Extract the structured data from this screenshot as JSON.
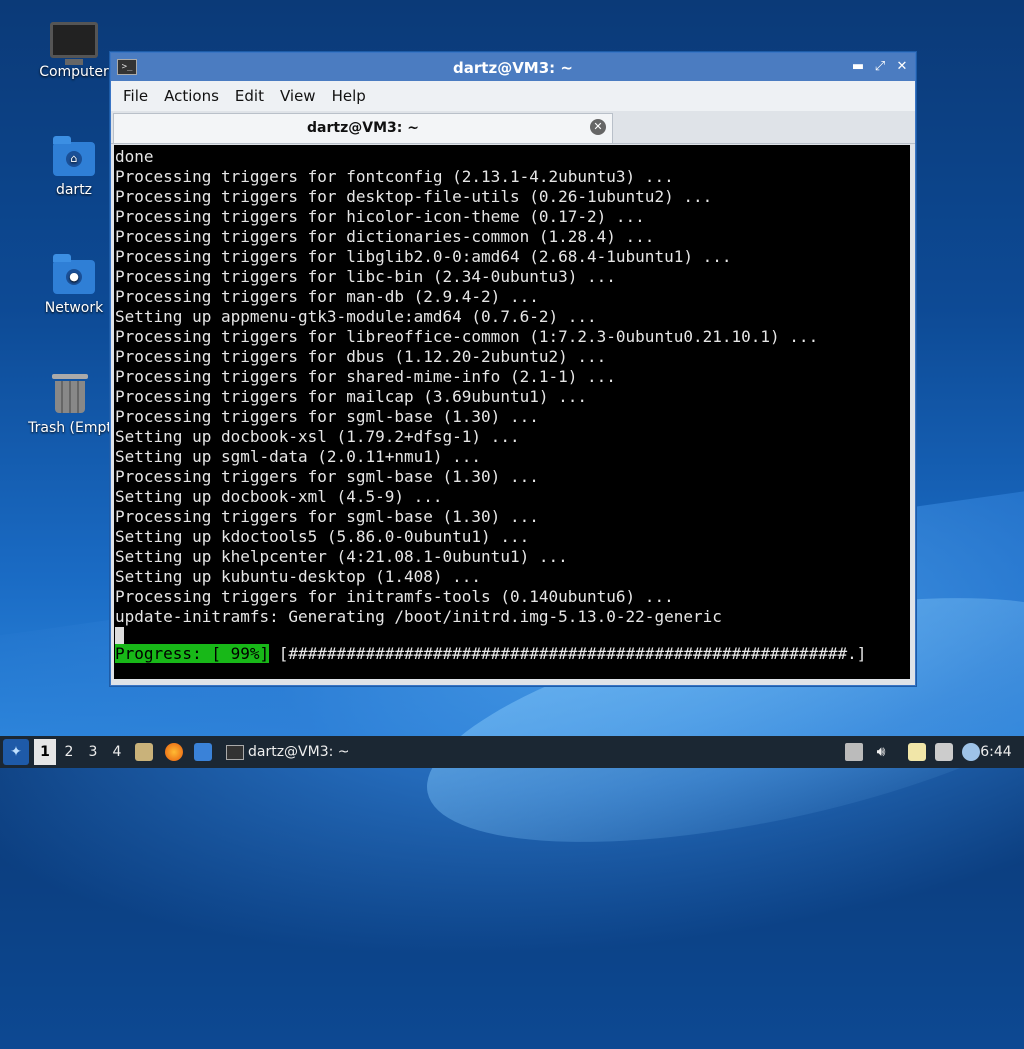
{
  "desktop": {
    "icons": [
      {
        "label": "Computer",
        "icon": "computer-icon"
      },
      {
        "label": "dartz",
        "icon": "home-folder-icon"
      },
      {
        "label": "Network",
        "icon": "network-folder-icon"
      },
      {
        "label": "Trash (Empt",
        "icon": "trash-icon"
      }
    ]
  },
  "window": {
    "title": "dartz@VM3: ~",
    "controls": {
      "minimize": "▬",
      "maximize": "⤢",
      "close": "✕"
    },
    "menu": [
      "File",
      "Actions",
      "Edit",
      "View",
      "Help"
    ],
    "tab": {
      "label": "dartz@VM3: ~",
      "close": "✕"
    },
    "terminal": {
      "lines": [
        "done",
        "Processing triggers for fontconfig (2.13.1-4.2ubuntu3) ...",
        "Processing triggers for desktop-file-utils (0.26-1ubuntu2) ...",
        "Processing triggers for hicolor-icon-theme (0.17-2) ...",
        "Processing triggers for dictionaries-common (1.28.4) ...",
        "Processing triggers for libglib2.0-0:amd64 (2.68.4-1ubuntu1) ...",
        "Processing triggers for libc-bin (2.34-0ubuntu3) ...",
        "Processing triggers for man-db (2.9.4-2) ...",
        "Setting up appmenu-gtk3-module:amd64 (0.7.6-2) ...",
        "Processing triggers for libreoffice-common (1:7.2.3-0ubuntu0.21.10.1) ...",
        "Processing triggers for dbus (1.12.20-2ubuntu2) ...",
        "Processing triggers for shared-mime-info (2.1-1) ...",
        "Processing triggers for mailcap (3.69ubuntu1) ...",
        "Processing triggers for sgml-base (1.30) ...",
        "Setting up docbook-xsl (1.79.2+dfsg-1) ...",
        "Setting up sgml-data (2.0.11+nmu1) ...",
        "Processing triggers for sgml-base (1.30) ...",
        "Setting up docbook-xml (4.5-9) ...",
        "Processing triggers for sgml-base (1.30) ...",
        "Setting up kdoctools5 (5.86.0-0ubuntu1) ...",
        "Setting up khelpcenter (4:21.08.1-0ubuntu1) ...",
        "Setting up kubuntu-desktop (1.408) ...",
        "Processing triggers for initramfs-tools (0.140ubuntu6) ...",
        "update-initramfs: Generating /boot/initrd.img-5.13.0-22-generic"
      ],
      "progress": {
        "label": "Progress: [ 99%]",
        "bar": " [##########################################################.]",
        "percent": 99
      }
    }
  },
  "taskbar": {
    "workspaces": [
      "1",
      "2",
      "3",
      "4"
    ],
    "active_workspace": "1",
    "launchers": [
      "file-manager-icon",
      "firefox-icon",
      "show-desktop-icon"
    ],
    "task_label": "dartz@VM3: ~",
    "tray_icons": [
      "eject-icon",
      "volume-icon",
      "clipboard-icon",
      "network-icon",
      "update-notifier-icon"
    ],
    "clock": "6:44"
  }
}
